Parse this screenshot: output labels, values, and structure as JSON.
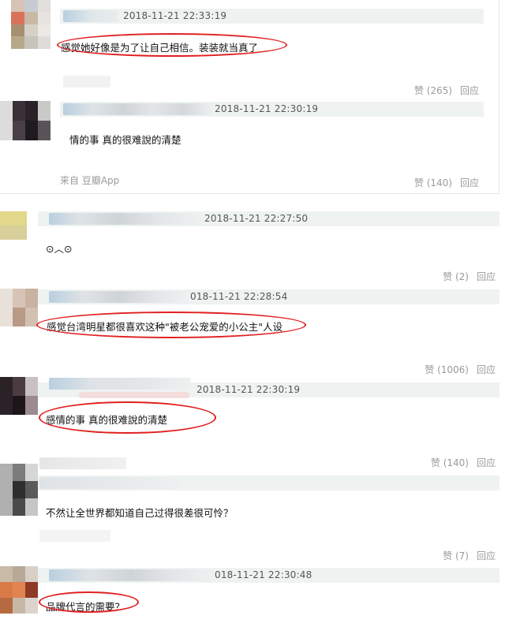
{
  "colors": {
    "annotation": "#e02020",
    "meta_bar": "#eef3f2",
    "muted": "#9a9a9a"
  },
  "replies": [
    {
      "timestamp": "2018-11-21 22:33:19",
      "content": "感觉她好像是为了让自己相信。装装就当真了",
      "likes": "赞 (265)",
      "reply": "回应"
    },
    {
      "timestamp": "2018-11-21 22:30:19",
      "content": "情的事 真的很难說的清楚",
      "source": "来自 豆瓣App",
      "likes": "赞 (140)",
      "reply": "回应"
    }
  ],
  "comments": [
    {
      "timestamp": "2018-11-21 22:27:50",
      "content": "⊙︿⊙",
      "likes": "赞 (2)",
      "reply": "回应"
    },
    {
      "timestamp": "018-11-21 22:28:54",
      "content": "感觉台湾明星都很喜欢这种\"被老公宠爱的小公主\"人设",
      "likes": "赞 (1006)",
      "reply": "回应"
    },
    {
      "timestamp": "2018-11-21 22:30:19",
      "content": "感情的事 真的很难說的清楚",
      "likes": "赞 (140)",
      "reply": "回应"
    },
    {
      "timestamp": "",
      "content": "不然让全世界都知道自己过得很差很可怜？",
      "likes": "赞 (7)",
      "reply": "回应"
    },
    {
      "timestamp": "018-11-21 22:30:48",
      "content": "品牌代言的需要？",
      "likes": "",
      "reply": ""
    }
  ]
}
